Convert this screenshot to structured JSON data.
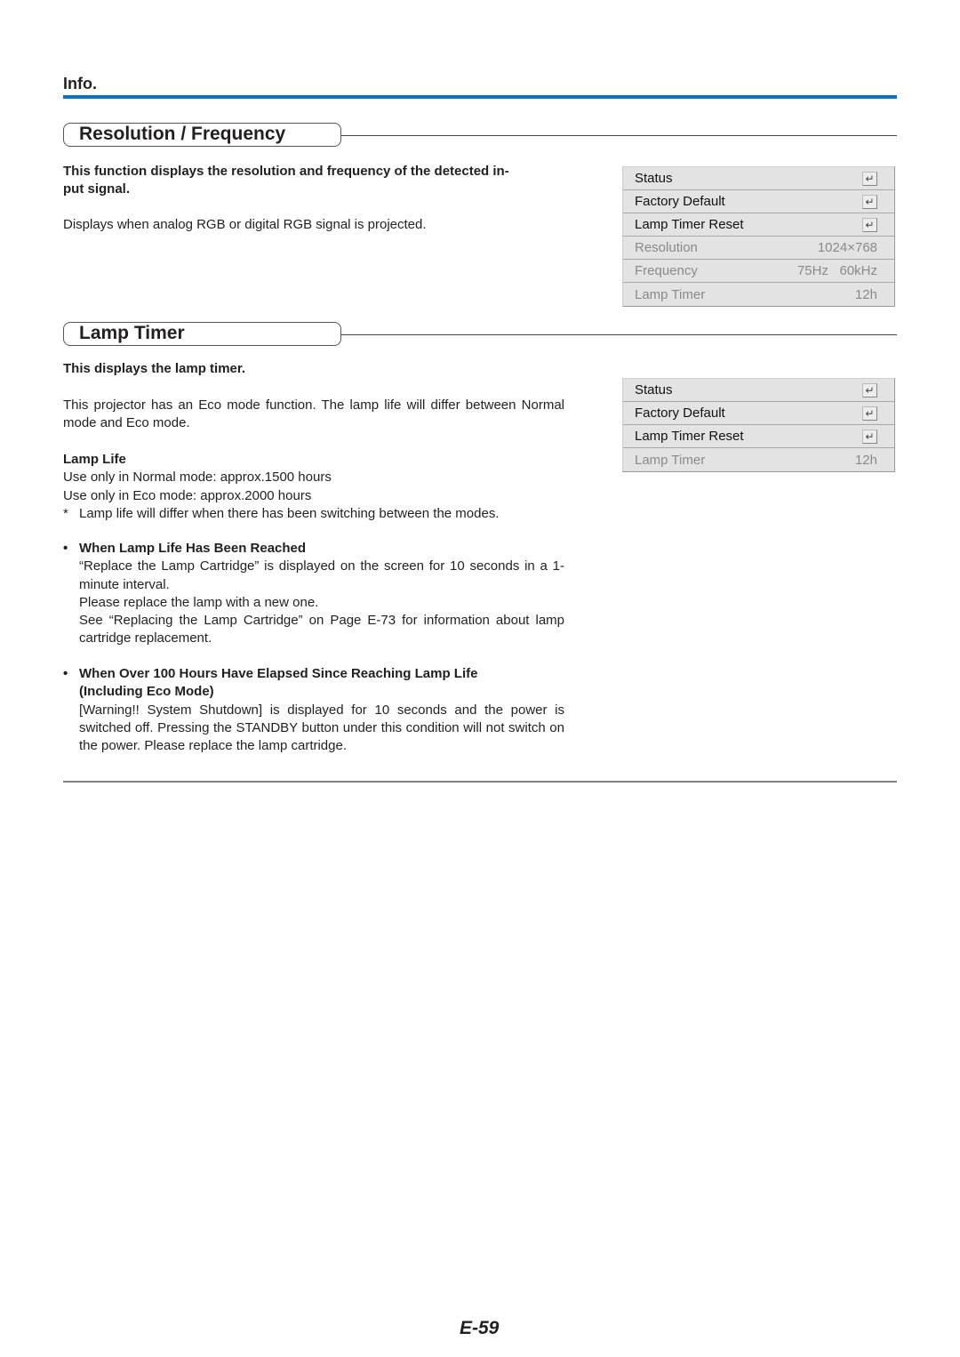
{
  "header": {
    "section_label": "Info.",
    "accent_color": "#0a72c6"
  },
  "resolution_frequency": {
    "title": "Resolution / Frequency",
    "lead": "This function displays the resolution and frequency of the detected in-put signal.",
    "lead_line1": "This function displays the resolution and frequency of the detected in-",
    "lead_line2": "put signal.",
    "body": "Displays when analog RGB or digital RGB signal is projected.",
    "menu": [
      {
        "label": "Status",
        "value": "",
        "icon": "enter-icon",
        "state": "active"
      },
      {
        "label": "Factory Default",
        "value": "",
        "icon": "enter-icon",
        "state": "active"
      },
      {
        "label": "Lamp Timer Reset",
        "value": "",
        "icon": "enter-icon",
        "state": "active"
      },
      {
        "label": "Resolution",
        "value": "1024×768",
        "icon": "",
        "state": "disabled"
      },
      {
        "label": "Frequency",
        "value": "75Hz   60kHz",
        "icon": "",
        "state": "disabled"
      },
      {
        "label": "Lamp Timer",
        "value": "12h",
        "icon": "",
        "state": "disabled"
      }
    ]
  },
  "lamp_timer": {
    "title": "Lamp Timer",
    "lead": "This displays the lamp timer.",
    "intro": "This projector has an Eco mode function. The lamp life will differ between Normal mode and Eco mode.",
    "lamp_life_heading": "Lamp Life",
    "lamp_life_normal": "Use only in Normal mode: approx.1500 hours",
    "lamp_life_eco": "Use only in Eco mode: approx.2000 hours",
    "note_mark": "*",
    "note": "Lamp life will differ when there has been switching between the modes.",
    "bullet_char": "•",
    "items": [
      {
        "heading": "When Lamp Life Has Been Reached",
        "lines": [
          "“Replace the Lamp Cartridge” is displayed on the screen for 10 seconds in a 1-minute interval.",
          "Please replace the lamp with a new one.",
          "See “Replacing the Lamp Cartridge” on Page E-73 for information about lamp cartridge replacement."
        ]
      },
      {
        "heading": "When Over 100 Hours Have Elapsed Since Reaching Lamp Life (Including Eco Mode)",
        "lines": [
          "[Warning!! System Shutdown] is displayed for 10 seconds and the power is switched off. Pressing the STANDBY button under this condition will not switch on the power. Please replace the lamp cartridge."
        ]
      }
    ],
    "menu": [
      {
        "label": "Status",
        "value": "",
        "icon": "enter-icon",
        "state": "active"
      },
      {
        "label": "Factory Default",
        "value": "",
        "icon": "enter-icon",
        "state": "active"
      },
      {
        "label": "Lamp Timer Reset",
        "value": "",
        "icon": "enter-icon",
        "state": "active"
      },
      {
        "label": "Lamp Timer",
        "value": "12h",
        "icon": "",
        "state": "disabled"
      }
    ]
  },
  "icons": {
    "enter_glyph": "↵"
  },
  "footer": {
    "page_number": "E-59"
  }
}
